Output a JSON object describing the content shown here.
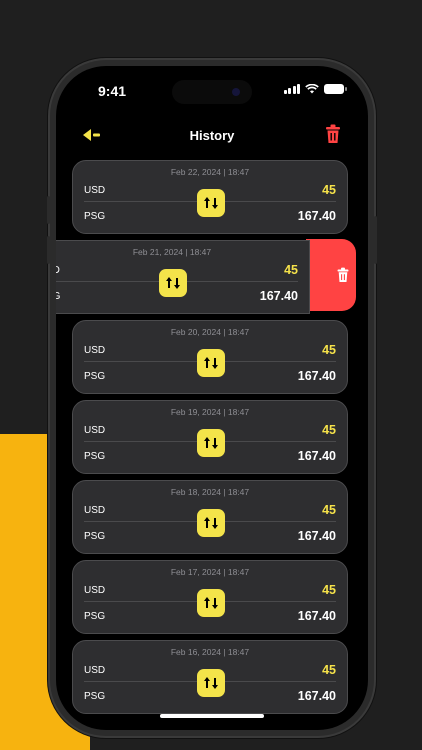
{
  "status_bar": {
    "time": "9:41"
  },
  "nav": {
    "title": "History"
  },
  "colors": {
    "accent": "#f3e34a",
    "delete": "#ff4343",
    "promo": "#f7b30f"
  },
  "history": [
    {
      "date": "Feb 22, 2024 | 18:47",
      "from_currency": "USD",
      "to_currency": "PSG",
      "from_value": "45",
      "to_value": "167.40"
    },
    {
      "date": "Feb 21, 2024 | 18:47",
      "from_currency": "SD",
      "to_currency": "SG",
      "from_value": "45",
      "to_value": "167.40"
    },
    {
      "date": "Feb 20, 2024 | 18:47",
      "from_currency": "USD",
      "to_currency": "PSG",
      "from_value": "45",
      "to_value": "167.40"
    },
    {
      "date": "Feb 19, 2024 | 18:47",
      "from_currency": "USD",
      "to_currency": "PSG",
      "from_value": "45",
      "to_value": "167.40"
    },
    {
      "date": "Feb 18, 2024 | 18:47",
      "from_currency": "USD",
      "to_currency": "PSG",
      "from_value": "45",
      "to_value": "167.40"
    },
    {
      "date": "Feb 17, 2024 | 18:47",
      "from_currency": "USD",
      "to_currency": "PSG",
      "from_value": "45",
      "to_value": "167.40"
    },
    {
      "date": "Feb 16, 2024 | 18:47",
      "from_currency": "USD",
      "to_currency": "PSG",
      "from_value": "45",
      "to_value": "167.40"
    }
  ]
}
